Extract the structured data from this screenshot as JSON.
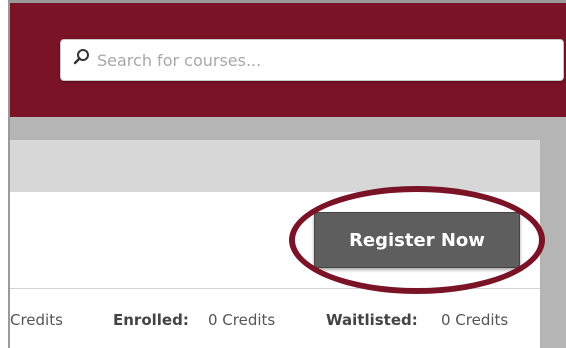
{
  "search": {
    "placeholder": "Search for courses..."
  },
  "register": {
    "label": "Register Now"
  },
  "credits": {
    "partial_value": "Credits",
    "enrolled_label": "Enrolled:",
    "enrolled_value": "0 Credits",
    "waitlisted_label": "Waitlisted:",
    "waitlisted_value": "0 Credits"
  },
  "colors": {
    "brand_maroon": "#7a1326",
    "button_gray": "#5e5e5e"
  },
  "icons": {
    "search": "search-icon"
  }
}
